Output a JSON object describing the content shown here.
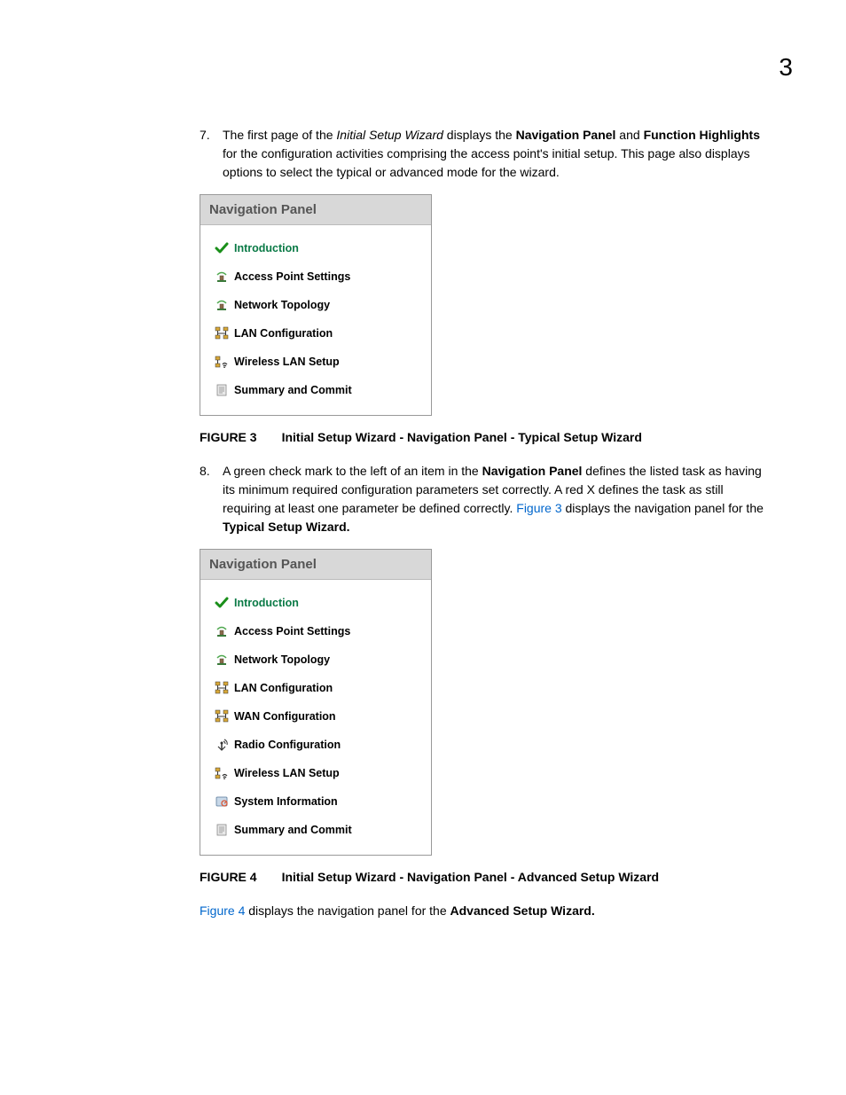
{
  "page_number": "3",
  "step7": {
    "num": "7.",
    "t1": "The first page of the ",
    "italic": "Initial Setup Wizard",
    "t2": " displays the ",
    "b1": "Navigation Panel",
    "t3": " and ",
    "b2": "Function Highlights",
    "t4": " for the configuration activities comprising the access point's initial setup. This page also displays options to select the typical or advanced mode for the wizard."
  },
  "panel1": {
    "title": "Navigation Panel",
    "items": [
      {
        "label": "Introduction",
        "icon": "check",
        "active": true
      },
      {
        "label": "Access Point Settings",
        "icon": "ap",
        "active": false
      },
      {
        "label": "Network Topology",
        "icon": "ap",
        "active": false
      },
      {
        "label": "LAN Configuration",
        "icon": "lan",
        "active": false
      },
      {
        "label": "Wireless LAN Setup",
        "icon": "wlan",
        "active": false
      },
      {
        "label": "Summary and Commit",
        "icon": "doc",
        "active": false
      }
    ]
  },
  "figure3": {
    "label": "FIGURE 3",
    "caption": "Initial Setup Wizard - Navigation Panel - Typical Setup Wizard"
  },
  "step8": {
    "num": "8.",
    "t1": "A green check mark to the left of an item in the ",
    "b1": "Navigation Panel",
    "t2": " defines the listed task as having its minimum required configuration parameters set correctly. A red X defines the task as still requiring at least one parameter be defined correctly. ",
    "link": "Figure 3",
    "t3": " displays the navigation panel for the ",
    "b2": "Typical Setup Wizard."
  },
  "panel2": {
    "title": "Navigation Panel",
    "items": [
      {
        "label": "Introduction",
        "icon": "check",
        "active": true
      },
      {
        "label": "Access Point Settings",
        "icon": "ap",
        "active": false
      },
      {
        "label": "Network Topology",
        "icon": "ap",
        "active": false
      },
      {
        "label": "LAN Configuration",
        "icon": "lan",
        "active": false
      },
      {
        "label": "WAN Configuration",
        "icon": "lan",
        "active": false
      },
      {
        "label": "Radio Configuration",
        "icon": "radio",
        "active": false
      },
      {
        "label": "Wireless LAN Setup",
        "icon": "wlan",
        "active": false
      },
      {
        "label": "System Information",
        "icon": "sys",
        "active": false
      },
      {
        "label": "Summary and Commit",
        "icon": "doc",
        "active": false
      }
    ]
  },
  "figure4": {
    "label": "FIGURE 4",
    "caption": "Initial Setup Wizard - Navigation Panel - Advanced Setup Wizard"
  },
  "closing": {
    "link": "Figure 4",
    "t1": " displays the navigation panel for the ",
    "b1": "Advanced Setup Wizard."
  }
}
